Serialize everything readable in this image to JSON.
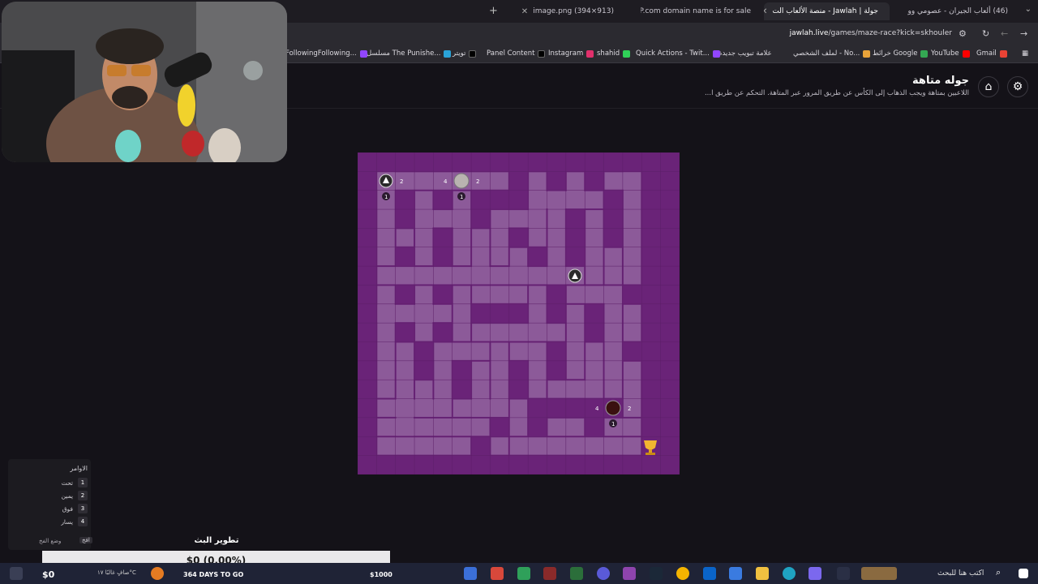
{
  "browser": {
    "tabs": [
      {
        "title": "(46) ألعاب الجيران - عصومي وو",
        "fav": "#e33",
        "active": false
      },
      {
        "title": "جولة | Jawlah - منصة الألعاب الت",
        "fav": "#ddd",
        "active": true
      },
      {
        "title": "PP.com domain name is for sale",
        "fav": "#2f6fe0",
        "active": false
      },
      {
        "title": "image.png (394×913)",
        "fav": "#fff",
        "active": false
      }
    ],
    "new_tab": "+",
    "url_domain": "jawlah.live",
    "url_path": "/games/maze-race?kick=skhouler",
    "bookmarks": [
      {
        "label": "Gmail",
        "color": "#ea4335"
      },
      {
        "label": "YouTube",
        "color": "#ff0000"
      },
      {
        "label": "خرائط Google",
        "color": "#34a853"
      },
      {
        "label": "لملف الشخصي - No...",
        "color": "#aaa"
      },
      {
        "label": "علامة تبويب جديدة",
        "color": "#9146ff"
      },
      {
        "label": "Quick Actions - Twit...",
        "color": "#9146ff"
      },
      {
        "label": "shahid",
        "color": "#30d158"
      },
      {
        "label": "Instagram",
        "color": "#e1306c"
      },
      {
        "label": "Panel Content",
        "color": "#222"
      },
      {
        "label": "تويتر",
        "color": "#222"
      },
      {
        "label": "مسلسل The Punishe...",
        "color": "#2aa3d8"
      },
      {
        "label": "FollowingFollowing...",
        "color": "#9146ff"
      }
    ]
  },
  "page": {
    "title": "جوله متاهة",
    "description": "اللاعبين بمتاهة ويجب الذهاب إلى الكأس عن طريق المرور عبر المتاهة. التحكم عن طريق ا..."
  },
  "maze": {
    "labels": {
      "p1_right": "2",
      "p1_down": "1",
      "p2_left": "4",
      "p2_right": "2",
      "p2_down": "1",
      "p3_left": "4",
      "p3_right": "2",
      "p3_down": "1"
    }
  },
  "commands": {
    "title": "الاوامر",
    "items": [
      {
        "key": "1",
        "label": "تحت"
      },
      {
        "key": "2",
        "label": "يمين"
      },
      {
        "key": "3",
        "label": "فوق"
      },
      {
        "key": "4",
        "label": "يسار"
      }
    ],
    "trap_label": "وضع الفخ",
    "trap_key": "افخ"
  },
  "stream": {
    "dev_title": "تطوير البث",
    "dev_value": "$0 (0.00%)",
    "days": "364 DAYS TO GO",
    "goal_start": "$0",
    "goal_end": "$1000"
  },
  "taskbar": {
    "search": "اكتب هنا للبحث",
    "weather": "صافٍ غالبًا ١٧°C"
  }
}
